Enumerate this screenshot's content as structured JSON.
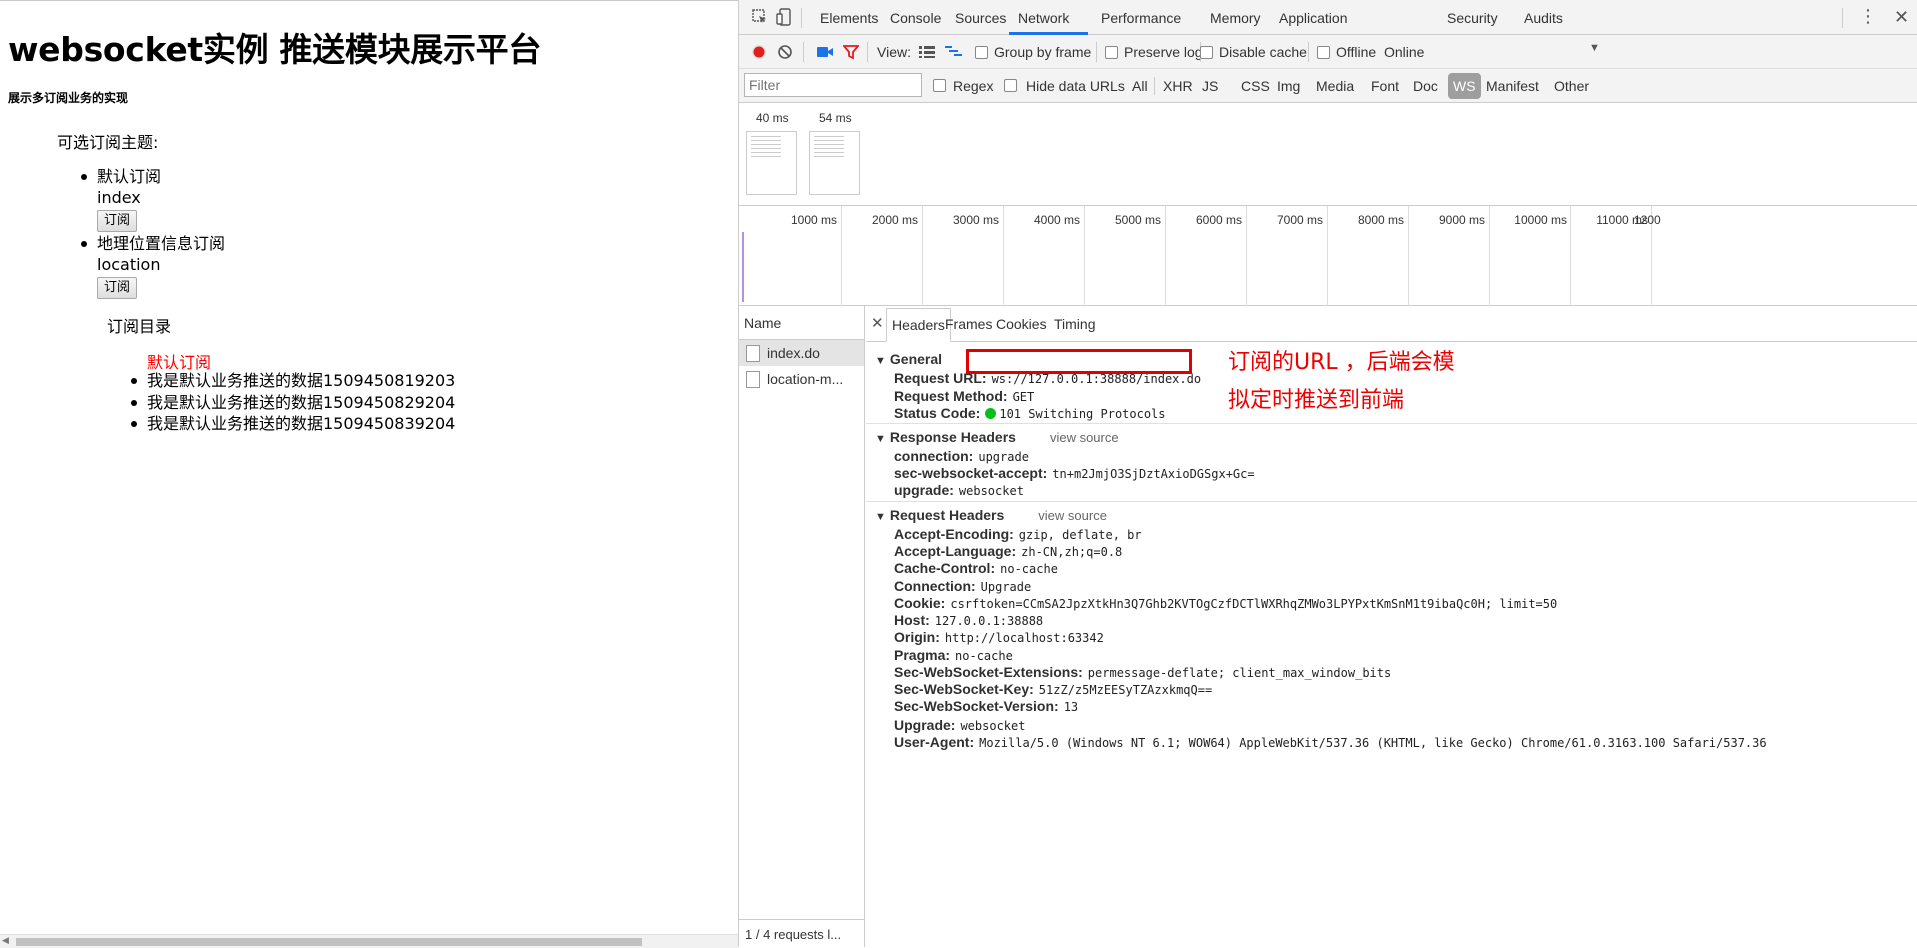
{
  "page": {
    "title": "websocket实例 推送模块展示平台",
    "subtitle": "展示多订阅业务的实现",
    "topics_label": "可选订阅主题:",
    "topics": [
      {
        "name": "默认订阅",
        "key": "index",
        "button": "订阅"
      },
      {
        "name": "地理位置信息订阅",
        "key": "location",
        "button": "订阅"
      }
    ],
    "directory_label": "订阅目录",
    "subscription_name": "默认订阅",
    "messages": [
      "我是默认业务推送的数据1509450819203",
      "我是默认业务推送的数据1509450829204",
      "我是默认业务推送的数据1509450839204"
    ]
  },
  "devtools": {
    "tabs": [
      "Elements",
      "Console",
      "Sources",
      "Network",
      "Performance",
      "Memory",
      "Application",
      "Security",
      "Audits"
    ],
    "active_tab": "Network",
    "toolbar": {
      "view_label": "View:",
      "group_by_frame": "Group by frame",
      "preserve_log": "Preserve log",
      "disable_cache": "Disable cache",
      "offline": "Offline",
      "throttle": "Online"
    },
    "filter": {
      "placeholder": "Filter",
      "regex": "Regex",
      "hide_data_urls": "Hide data URLs",
      "types": [
        "All",
        "XHR",
        "JS",
        "CSS",
        "Img",
        "Media",
        "Font",
        "Doc",
        "WS",
        "Manifest",
        "Other"
      ],
      "active_type": "WS"
    },
    "filmstrip": {
      "times": [
        "40 ms",
        "54 ms"
      ]
    },
    "overview": {
      "ticks": [
        "1000 ms",
        "2000 ms",
        "3000 ms",
        "4000 ms",
        "5000 ms",
        "6000 ms",
        "7000 ms",
        "8000 ms",
        "9000 ms",
        "10000 ms",
        "11000 ms",
        "1200"
      ]
    },
    "requests": {
      "column": "Name",
      "items": [
        "index.do",
        "location-m..."
      ],
      "footer": "1 / 4 requests  l..."
    },
    "detail": {
      "tabs": [
        "Headers",
        "Frames",
        "Cookies",
        "Timing"
      ],
      "general": {
        "title": "General",
        "rows": [
          {
            "k": "Request URL:",
            "v": "ws://127.0.0.1:38888/index.do"
          },
          {
            "k": "Request Method:",
            "v": "GET"
          },
          {
            "k": "Status Code:",
            "v": "101 Switching Protocols"
          }
        ]
      },
      "response_headers": {
        "title": "Response Headers",
        "view_source": "view source",
        "rows": [
          {
            "k": "connection:",
            "v": "upgrade"
          },
          {
            "k": "sec-websocket-accept:",
            "v": "tn+m2JmjO3SjDztAxioDGSgx+Gc="
          },
          {
            "k": "upgrade:",
            "v": "websocket"
          }
        ]
      },
      "request_headers": {
        "title": "Request Headers",
        "view_source": "view source",
        "rows": [
          {
            "k": "Accept-Encoding:",
            "v": "gzip, deflate, br"
          },
          {
            "k": "Accept-Language:",
            "v": "zh-CN,zh;q=0.8"
          },
          {
            "k": "Cache-Control:",
            "v": "no-cache"
          },
          {
            "k": "Connection:",
            "v": "Upgrade"
          },
          {
            "k": "Cookie:",
            "v": "csrftoken=CCmSA2JpzXtkHn3Q7Ghb2KVTOgCzfDCTlWXRhqZMWo3LPYPxtKmSnM1t9ibaQc0H; limit=50"
          },
          {
            "k": "Host:",
            "v": "127.0.0.1:38888"
          },
          {
            "k": "Origin:",
            "v": "http://localhost:63342"
          },
          {
            "k": "Pragma:",
            "v": "no-cache"
          },
          {
            "k": "Sec-WebSocket-Extensions:",
            "v": "permessage-deflate; client_max_window_bits"
          },
          {
            "k": "Sec-WebSocket-Key:",
            "v": "51zZ/z5MzEESyTZAzxkmqQ=="
          },
          {
            "k": "Sec-WebSocket-Version:",
            "v": "13"
          },
          {
            "k": "Upgrade:",
            "v": "websocket"
          },
          {
            "k": "User-Agent:",
            "v": "Mozilla/5.0 (Windows NT 6.1; WOW64) AppleWebKit/537.36 (KHTML, like Gecko) Chrome/61.0.3163.100 Safari/537.36"
          }
        ]
      }
    },
    "annotation": {
      "line1": "订阅的URL ，后端会模",
      "line2": "拟定时推送到前端",
      "color": "#ee0000"
    }
  }
}
